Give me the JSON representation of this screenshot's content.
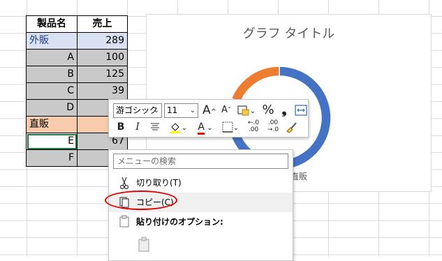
{
  "table": {
    "headers": [
      "製品名",
      "売上"
    ],
    "rows": [
      {
        "name": "外販",
        "value": "289",
        "kind": "group-blue"
      },
      {
        "name": "A",
        "value": "100",
        "kind": "item"
      },
      {
        "name": "B",
        "value": "125",
        "kind": "item"
      },
      {
        "name": "C",
        "value": "39",
        "kind": "item"
      },
      {
        "name": "D",
        "value": "",
        "kind": "item"
      },
      {
        "name": "直販",
        "value": "",
        "kind": "group-orange"
      },
      {
        "name": "E",
        "value": "67",
        "kind": "item-active"
      },
      {
        "name": "F",
        "value": "",
        "kind": "item"
      }
    ]
  },
  "chart": {
    "title": "グラフ タイトル",
    "legend_visible": "直販"
  },
  "chart_data": {
    "type": "pie",
    "title": "グラフ タイトル",
    "categories": [
      "外販",
      "直販"
    ],
    "values": [
      289,
      67
    ],
    "colors": [
      "#4472c4",
      "#ed7d31"
    ]
  },
  "toolbar": {
    "font_name": "游ゴシック",
    "font_size": "11",
    "grow_font": "A",
    "shrink_font": "A",
    "percent": "%",
    "comma": "❟",
    "bold": "B",
    "italic": "I",
    "font_color": "A",
    "decrease_decimal_top": "←.0",
    "decrease_decimal_bottom": ".00",
    "increase_decimal_top": ".00",
    "increase_decimal_bottom": "→.0"
  },
  "menu": {
    "search_placeholder": "メニューの検索",
    "cut": "切り取り(T)",
    "copy": "コピー(C)",
    "paste_options": "貼り付けのオプション:"
  },
  "colors": {
    "donut_blue": "#4472c4",
    "donut_orange": "#ed7d31",
    "highlight": "#e00000",
    "blue_group": "#d9e1f2",
    "orange_group": "#f8cbad",
    "item_gray": "#c9c9c9"
  },
  "icons": {
    "cut": "scissors-icon",
    "copy": "copy-icon",
    "paste": "clipboard-icon",
    "paste_option": "paste-clipboard-icon",
    "format_painter": "brush-icon",
    "borders": "border-icon",
    "fill": "paint-bucket-icon",
    "merge": "merge-center-icon",
    "accounting": "accounting-format-icon",
    "wrap": "wrap-text-icon"
  }
}
